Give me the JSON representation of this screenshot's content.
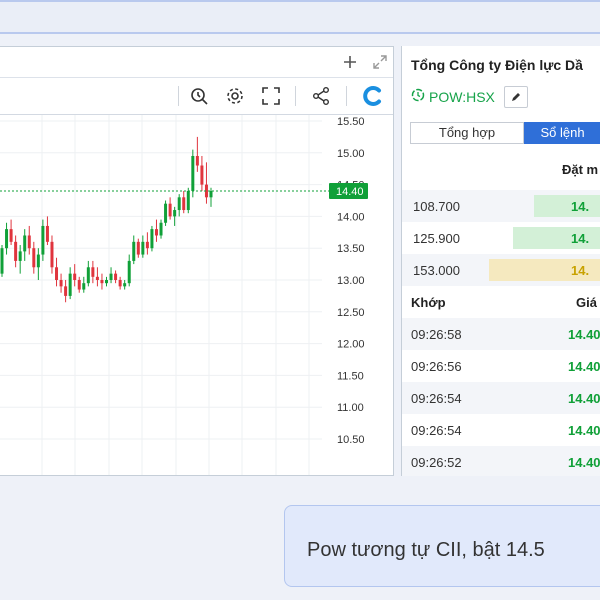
{
  "colors": {
    "up": "#10a038",
    "down": "#e0343d",
    "accent": "#2f6fd8",
    "ref": "#d8b400"
  },
  "chart_panel": {
    "header_icons": [
      "plus-icon",
      "expand-icon"
    ],
    "toolbar_icons": [
      "zoom-icon",
      "settings-icon",
      "fullscreen-icon",
      "share-icon",
      "brand-logo-icon"
    ]
  },
  "chart_data": {
    "type": "candlestick",
    "y_ticks": [
      "15.50",
      "15.00",
      "14.50",
      "14.00",
      "13.50",
      "13.00",
      "12.50",
      "12.00",
      "11.50",
      "11.00",
      "10.50"
    ],
    "ylim": [
      10.5,
      15.5
    ],
    "last_price": "14.40",
    "last_value": 14.4,
    "grid": true,
    "candles": [
      [
        13.1,
        13.55,
        13.05,
        13.5
      ],
      [
        13.5,
        13.9,
        13.4,
        13.8
      ],
      [
        13.8,
        13.95,
        13.55,
        13.6
      ],
      [
        13.6,
        13.7,
        13.2,
        13.3
      ],
      [
        13.3,
        13.55,
        13.1,
        13.45
      ],
      [
        13.45,
        13.8,
        13.3,
        13.7
      ],
      [
        13.7,
        13.85,
        13.4,
        13.5
      ],
      [
        13.5,
        13.6,
        13.1,
        13.2
      ],
      [
        13.2,
        13.5,
        13.0,
        13.4
      ],
      [
        13.4,
        13.95,
        13.3,
        13.85
      ],
      [
        13.85,
        14.0,
        13.55,
        13.6
      ],
      [
        13.6,
        13.7,
        13.1,
        13.2
      ],
      [
        13.2,
        13.35,
        12.9,
        13.0
      ],
      [
        13.0,
        13.1,
        12.8,
        12.9
      ],
      [
        12.9,
        13.0,
        12.65,
        12.75
      ],
      [
        12.75,
        13.2,
        12.7,
        13.1
      ],
      [
        13.1,
        13.25,
        12.9,
        13.0
      ],
      [
        13.0,
        13.05,
        12.8,
        12.85
      ],
      [
        12.85,
        13.05,
        12.8,
        12.95
      ],
      [
        12.95,
        13.3,
        12.9,
        13.2
      ],
      [
        13.2,
        13.3,
        12.95,
        13.05
      ],
      [
        13.05,
        13.2,
        12.9,
        13.0
      ],
      [
        13.0,
        13.1,
        12.85,
        12.95
      ],
      [
        12.95,
        13.05,
        12.9,
        13.0
      ],
      [
        13.0,
        13.2,
        12.95,
        13.1
      ],
      [
        13.1,
        13.15,
        12.95,
        13.0
      ],
      [
        13.0,
        13.05,
        12.85,
        12.9
      ],
      [
        12.9,
        13.0,
        12.85,
        12.95
      ],
      [
        12.95,
        13.4,
        12.9,
        13.3
      ],
      [
        13.3,
        13.7,
        13.25,
        13.6
      ],
      [
        13.6,
        13.65,
        13.35,
        13.4
      ],
      [
        13.4,
        13.7,
        13.35,
        13.6
      ],
      [
        13.6,
        13.75,
        13.4,
        13.5
      ],
      [
        13.5,
        13.85,
        13.45,
        13.8
      ],
      [
        13.8,
        13.95,
        13.6,
        13.7
      ],
      [
        13.7,
        13.95,
        13.65,
        13.9
      ],
      [
        13.9,
        14.25,
        13.85,
        14.2
      ],
      [
        14.2,
        14.3,
        13.95,
        14.0
      ],
      [
        14.0,
        14.15,
        13.85,
        14.1
      ],
      [
        14.1,
        14.35,
        14.0,
        14.3
      ],
      [
        14.3,
        14.4,
        14.05,
        14.1
      ],
      [
        14.1,
        14.45,
        14.05,
        14.4
      ],
      [
        14.4,
        15.05,
        14.3,
        14.95
      ],
      [
        14.95,
        15.25,
        14.7,
        14.8
      ],
      [
        14.8,
        14.95,
        14.4,
        14.5
      ],
      [
        14.5,
        14.85,
        14.2,
        14.3
      ],
      [
        14.3,
        14.45,
        14.15,
        14.4
      ]
    ]
  },
  "company": {
    "name": "Tổng Công ty Điện lực Dầ",
    "ticker": "POW:HSX"
  },
  "tabs": {
    "summary": "Tổng hợp",
    "orderbook": "Sổ lệnh"
  },
  "order_book": {
    "header": "Đặt m",
    "rows": [
      {
        "volume": "108.700",
        "price": "14.",
        "bar_fraction": 0.42,
        "color": "#d3f0d7",
        "text_color": "#10a038"
      },
      {
        "volume": "125.900",
        "price": "14.",
        "bar_fraction": 0.55,
        "color": "#d3f0d7",
        "text_color": "#10a038"
      },
      {
        "volume": "153.000",
        "price": "14.",
        "bar_fraction": 0.7,
        "color": "#f5e9bf",
        "text_color": "#c8a200"
      }
    ]
  },
  "match": {
    "time_header": "Khớp",
    "price_header": "Giá",
    "rows": [
      {
        "time": "09:26:58",
        "price": "14.40"
      },
      {
        "time": "09:26:56",
        "price": "14.40"
      },
      {
        "time": "09:26:54",
        "price": "14.40"
      },
      {
        "time": "09:26:54",
        "price": "14.40"
      },
      {
        "time": "09:26:52",
        "price": "14.40"
      }
    ]
  },
  "chat": {
    "message": "Pow tương tự CII, bật 14.5"
  }
}
